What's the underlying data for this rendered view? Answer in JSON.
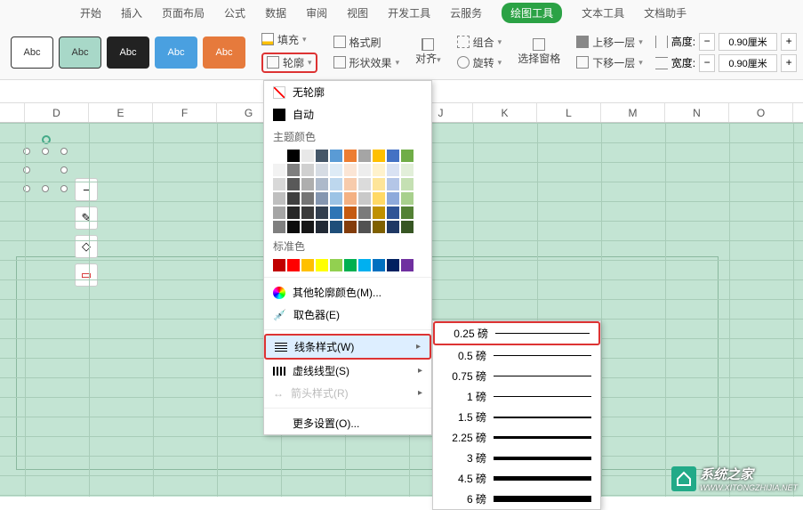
{
  "tabs": [
    "开始",
    "插入",
    "页面布局",
    "公式",
    "数据",
    "审阅",
    "视图",
    "开发工具",
    "云服务",
    "绘图工具",
    "文本工具",
    "文档助手"
  ],
  "active_tab": "绘图工具",
  "shape_label": "Abc",
  "ribbon": {
    "fill": "填充",
    "format_painter": "格式刷",
    "outline": "轮廓",
    "shape_effect": "形状效果",
    "align": "对齐",
    "combine": "组合",
    "rotate": "旋转",
    "select_pane": "选择窗格",
    "bring_forward": "上移一层",
    "send_backward": "下移一层",
    "height_label": "高度:",
    "width_label": "宽度:",
    "height_value": "0.90厘米",
    "width_value": "0.90厘米"
  },
  "columns": [
    "",
    "D",
    "E",
    "F",
    "G",
    "",
    "",
    "J",
    "K",
    "L",
    "M",
    "N",
    "O"
  ],
  "outline_menu": {
    "no_outline": "无轮廓",
    "auto": "自动",
    "theme_colors": "主题颜色",
    "standard_colors": "标准色",
    "more_colors": "其他轮廓颜色(M)...",
    "eyedropper": "取色器(E)",
    "line_style": "线条样式(W)",
    "dash_type": "虚线线型(S)",
    "arrow_style": "箭头样式(R)",
    "more_settings": "更多设置(O)..."
  },
  "theme_palette": [
    [
      "#ffffff",
      "#000000",
      "#e8e8e8",
      "#445668",
      "#5a9bd5",
      "#ed7d31",
      "#a5a5a5",
      "#ffc000",
      "#4472c4",
      "#70ad47"
    ],
    [
      "#f2f2f2",
      "#7f7f7f",
      "#d0d0d0",
      "#d6dce4",
      "#deebf6",
      "#fbe5d5",
      "#ededed",
      "#fff2cc",
      "#d9e2f3",
      "#e2efd9"
    ],
    [
      "#d8d8d8",
      "#595959",
      "#aeaeae",
      "#adb9ca",
      "#bdd7ee",
      "#f7cbac",
      "#dbdbdb",
      "#fee599",
      "#b4c6e7",
      "#c5e0b3"
    ],
    [
      "#bfbfbf",
      "#3f3f3f",
      "#757575",
      "#8496b0",
      "#9cc3e5",
      "#f4b183",
      "#c9c9c9",
      "#ffd965",
      "#8eaadb",
      "#a8d08d"
    ],
    [
      "#a5a5a5",
      "#262626",
      "#3a3a3a",
      "#323f4f",
      "#2e75b5",
      "#c55a11",
      "#7b7b7b",
      "#bf9000",
      "#2f5496",
      "#538135"
    ],
    [
      "#7f7f7f",
      "#0c0c0c",
      "#161616",
      "#222a35",
      "#1e4e79",
      "#833c0b",
      "#525252",
      "#7f6000",
      "#1f3864",
      "#375623"
    ]
  ],
  "standard_palette": [
    "#c00000",
    "#ff0000",
    "#ffc000",
    "#ffff00",
    "#92d050",
    "#00b050",
    "#00b0f0",
    "#0070c0",
    "#002060",
    "#7030a0"
  ],
  "line_weights": [
    {
      "label": "0.25 磅",
      "h": 1
    },
    {
      "label": "0.5 磅",
      "h": 1
    },
    {
      "label": "0.75 磅",
      "h": 1
    },
    {
      "label": "1 磅",
      "h": 1.5
    },
    {
      "label": "1.5 磅",
      "h": 2
    },
    {
      "label": "2.25 磅",
      "h": 3
    },
    {
      "label": "3 磅",
      "h": 4
    },
    {
      "label": "4.5 磅",
      "h": 5
    },
    {
      "label": "6 磅",
      "h": 7
    }
  ],
  "watermark": {
    "brand": "系统之家",
    "url": "WWW.XITONGZHIJIA.NET"
  }
}
